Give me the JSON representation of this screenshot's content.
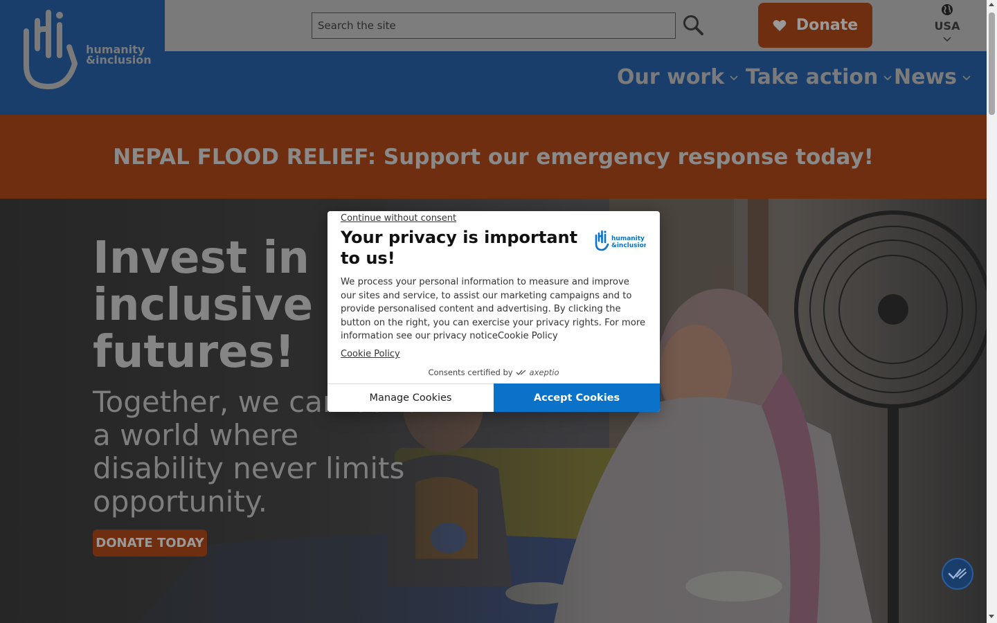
{
  "header": {
    "logo": {
      "line1": "humanity",
      "line2": "&inclusion",
      "mark": "hi-hand-logo"
    },
    "search": {
      "placeholder": "Search the site",
      "value": "",
      "icon": "search-icon"
    },
    "donate": {
      "label": "Donate",
      "icon": "heart-icon"
    },
    "country": {
      "label": "USA",
      "icon": "globe-icon"
    }
  },
  "nav": {
    "items": [
      {
        "label": "Our work"
      },
      {
        "label": "Take action"
      },
      {
        "label": "News"
      }
    ]
  },
  "banner": {
    "text": "NEPAL FLOOD RELIEF: Support our emergency response today!"
  },
  "hero": {
    "title": "Invest in inclusive futures!",
    "subtitle": "Together, we can build a world where disability never limits opportunity.",
    "cta": "DONATE TODAY"
  },
  "consent": {
    "skip_link": "Continue without consent",
    "title": "Your privacy is important to us!",
    "logo": {
      "line1": "humanity",
      "line2": "&inclusion"
    },
    "body": "We process your personal information to measure and improve our sites and service, to assist our marketing campaigns and to provide personalised content and advertising. By clicking the button on the right, you can exercise your privacy rights. For more information see our privacy noticeCookie Policy",
    "cookie_policy_link": "Cookie Policy",
    "certified_text": "Consents certified by",
    "certified_brand": "axeptio",
    "manage_label": "Manage Cookies",
    "accept_label": "Accept Cookies"
  },
  "colors": {
    "brand_blue": "#0a72c8",
    "header_blue_dimmed": "#1a3e6b",
    "brand_orange_dimmed": "#6e2e0f"
  }
}
